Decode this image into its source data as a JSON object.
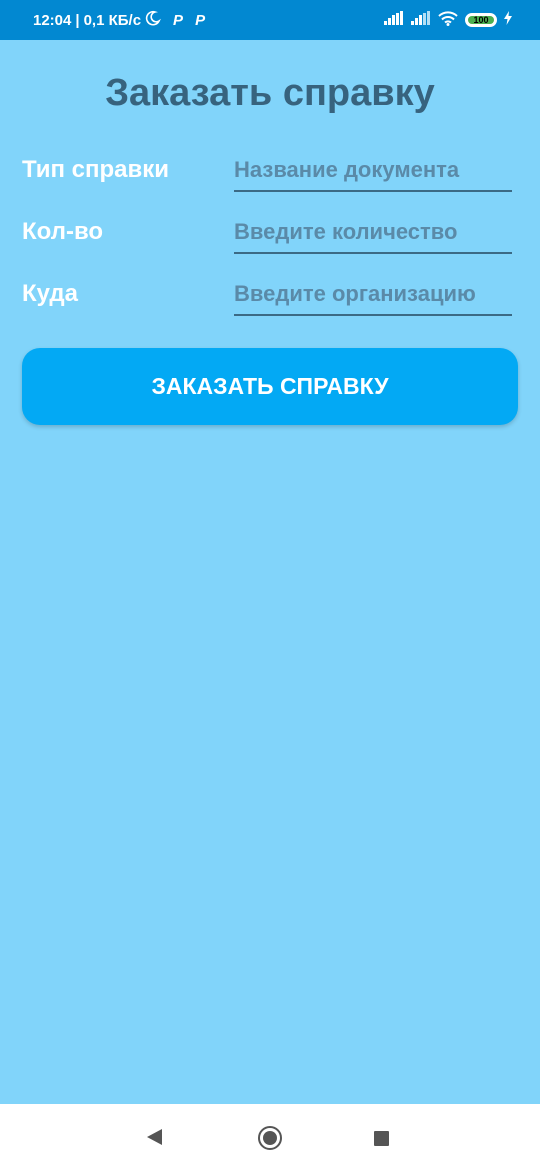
{
  "status_bar": {
    "time": "12:04",
    "separator": "|",
    "net_speed": "0,1 КБ/с",
    "battery_level": "100",
    "icons": [
      "moon-icon",
      "p-app-icon",
      "p-app-icon",
      "signal-icon",
      "signal-icon",
      "wifi-icon",
      "battery-icon",
      "charging-icon"
    ]
  },
  "page": {
    "title": "Заказать справку"
  },
  "form": {
    "rows": [
      {
        "label": "Тип справки",
        "placeholder": "Название документа",
        "value": ""
      },
      {
        "label": "Кол-во",
        "placeholder": "Введите количество",
        "value": ""
      },
      {
        "label": "Куда",
        "placeholder": "Введите организацию",
        "value": ""
      }
    ],
    "submit_label": "ЗАКАЗАТЬ СПРАВКУ"
  },
  "nav_bar": {
    "icons": [
      "back-icon",
      "home-icon",
      "recents-icon"
    ]
  },
  "colors": {
    "background": "#81d4fa",
    "status_bar": "#0288d1",
    "button": "#03a9f4",
    "title": "#37637e"
  }
}
